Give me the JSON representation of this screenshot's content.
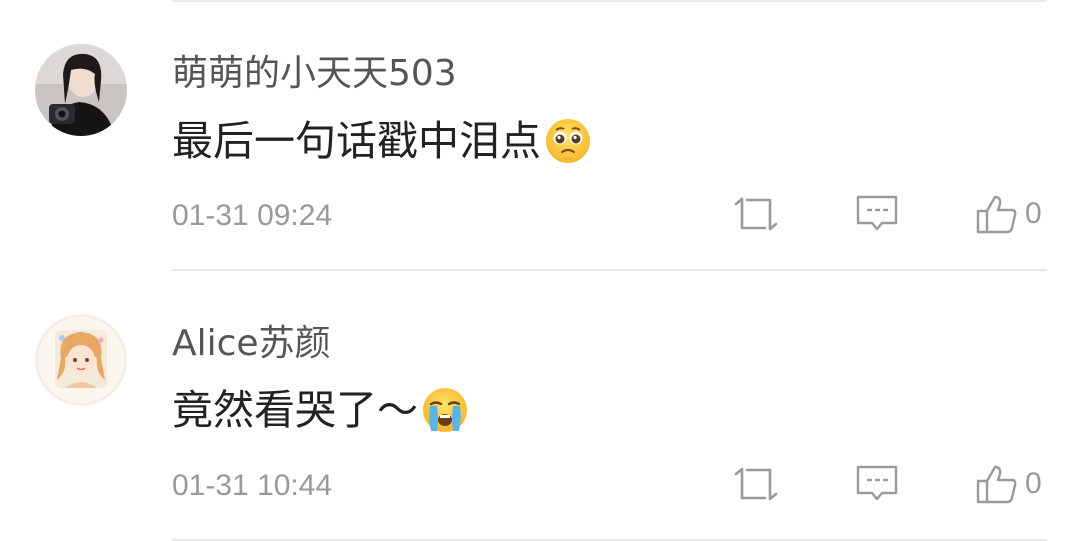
{
  "comments": [
    {
      "username": "萌萌的小天天503",
      "text": "最后一句话戳中泪点",
      "emoji_icon": "pleading-face-icon",
      "timestamp": "01-31 09:24",
      "like_count": "0",
      "avatar_icon": "user-avatar-icon"
    },
    {
      "username": "Alice苏颜",
      "text": "竟然看哭了～",
      "emoji_icon": "loudly-crying-face-icon",
      "timestamp": "01-31 10:44",
      "like_count": "0",
      "avatar_icon": "user-avatar-icon"
    }
  ],
  "actions": {
    "repost_icon": "repost-icon",
    "reply_icon": "comment-icon",
    "like_icon": "thumbs-up-icon"
  },
  "colors": {
    "divider": "#e9e9e9",
    "secondary_text": "#999999",
    "username": "#555555",
    "body_text": "#222222"
  }
}
